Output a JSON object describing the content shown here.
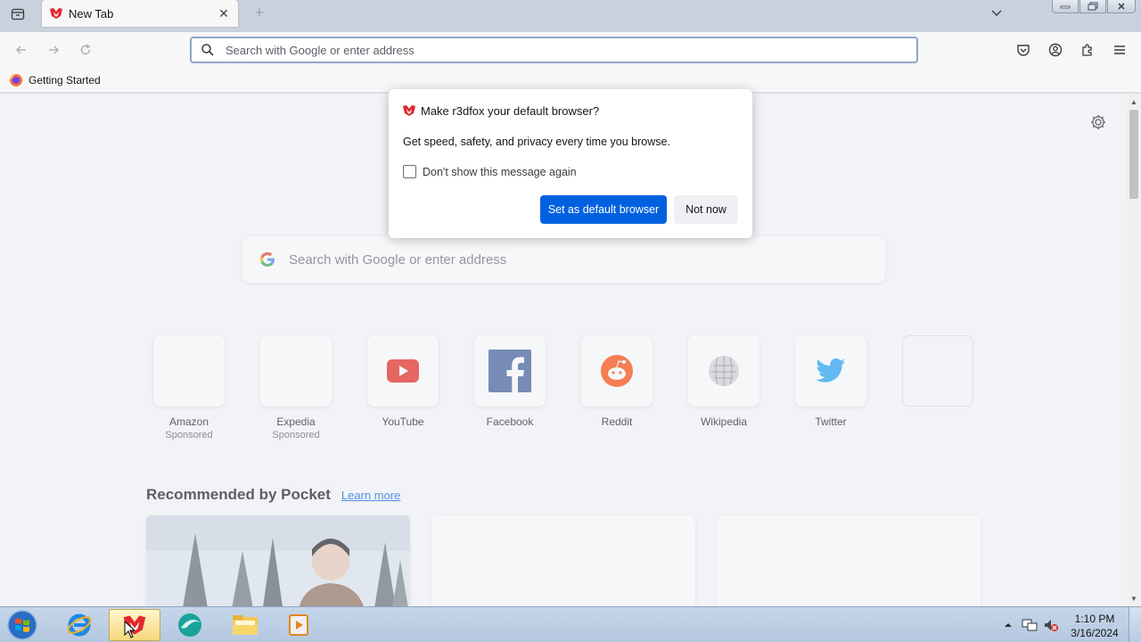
{
  "colors": {
    "accent": "#0061e0",
    "link": "#0060df",
    "brand_red": "#e0282e"
  },
  "tab": {
    "title": "New Tab",
    "close_glyph": "✕",
    "new_tab_glyph": "+"
  },
  "urlbar": {
    "placeholder": "Search with Google or enter address"
  },
  "bookmarks": [
    {
      "label": "Getting Started"
    }
  ],
  "newtab": {
    "search_placeholder": "Search with Google or enter address",
    "top_sites": [
      {
        "name": "Amazon",
        "sponsored": "Sponsored",
        "icon": "blank"
      },
      {
        "name": "Expedia",
        "sponsored": "Sponsored",
        "icon": "blank"
      },
      {
        "name": "YouTube",
        "sponsored": "",
        "icon": "youtube-icon"
      },
      {
        "name": "Facebook",
        "sponsored": "",
        "icon": "facebook-icon"
      },
      {
        "name": "Reddit",
        "sponsored": "",
        "icon": "reddit-icon"
      },
      {
        "name": "Wikipedia",
        "sponsored": "",
        "icon": "wikipedia-icon"
      },
      {
        "name": "Twitter",
        "sponsored": "",
        "icon": "twitter-icon"
      },
      {
        "name": "",
        "sponsored": "",
        "icon": "empty"
      }
    ],
    "pocket_title": "Recommended by Pocket",
    "pocket_link": "Learn more"
  },
  "dialog": {
    "title": "Make r3dfox your default browser?",
    "body": "Get speed, safety, and privacy every time you browse.",
    "checkbox_label": "Don't show this message again",
    "primary_button": "Set as default browser",
    "secondary_button": "Not now"
  },
  "taskbar": {
    "apps": [
      "start-button",
      "internet-explorer",
      "r3dfox",
      "browser-green",
      "file-explorer",
      "media-player"
    ],
    "clock_time": "1:10 PM",
    "clock_date": "3/16/2024"
  }
}
